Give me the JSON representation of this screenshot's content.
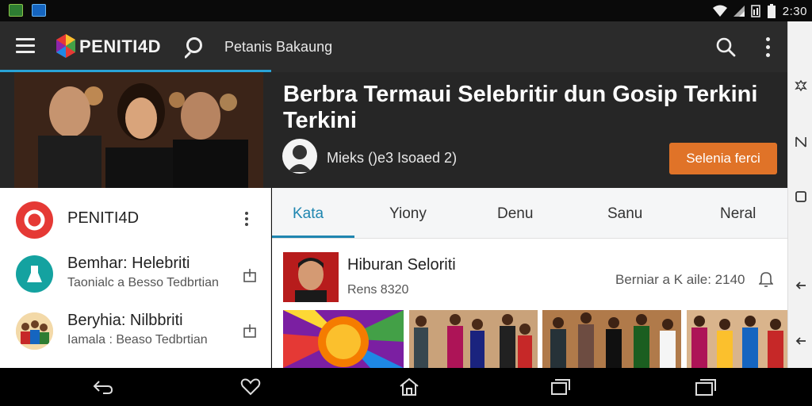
{
  "status_bar": {
    "time": "2:30",
    "icons": [
      "notification-app-icon",
      "notification-sync-icon",
      "wifi-icon",
      "signal-icon",
      "sim-icon",
      "battery-icon"
    ]
  },
  "app_bar": {
    "brand": "PENITI4D",
    "search_label": "Petanis Bakaung",
    "icons": [
      "menu-icon",
      "logo-icon",
      "search-icon",
      "search-icon",
      "more-icon"
    ]
  },
  "hero": {
    "title": "Berbra Termaui Selebritir dun Gosip Terkini Terkini",
    "meta": "Mieks ()e3 Isoaed 2)",
    "cta_label": "Selenia ferci"
  },
  "left_list": {
    "header": {
      "title": "PENITI4D"
    },
    "items": [
      {
        "title": "Bemhar: Helebriti",
        "subtitle": "Taonialc a Besso Tedbrtian"
      },
      {
        "title": "Beryhia: Nilbbriti",
        "subtitle": "Iamala : Beaso Tedbrtian"
      }
    ]
  },
  "tabs": [
    {
      "label": "Kata",
      "active": true
    },
    {
      "label": "Yiony",
      "active": false
    },
    {
      "label": "Denu",
      "active": false
    },
    {
      "label": "Sanu",
      "active": false
    },
    {
      "label": "Neral",
      "active": false
    }
  ],
  "feed": {
    "title": "Hiburan Seloriti",
    "subtitle": "Rens 8320",
    "stat": "Berniar a K aile: 2140"
  },
  "colors": {
    "accent": "#1f86b0",
    "cta": "#e07328",
    "appbar": "#2b2b2b",
    "hero_bg": "#262626"
  }
}
